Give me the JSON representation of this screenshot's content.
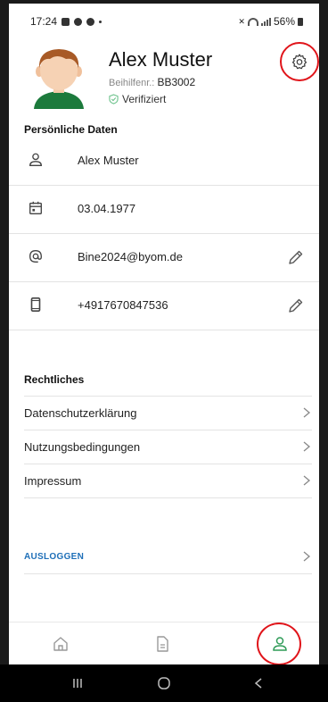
{
  "status_bar": {
    "time": "17:24",
    "battery": "56%"
  },
  "profile": {
    "name": "Alex Muster",
    "beihilfe_label": "Beihilfenr.:",
    "beihilfe_number": "BB3002",
    "verified_label": "Verifiziert"
  },
  "personal": {
    "title": "Persönliche Daten",
    "rows": [
      {
        "icon": "person-icon",
        "value": "Alex Muster",
        "editable": false
      },
      {
        "icon": "calendar-icon",
        "value": "03.04.1977",
        "editable": false
      },
      {
        "icon": "at-icon",
        "value": "Bine2024@byom.de",
        "editable": true
      },
      {
        "icon": "phone-icon",
        "value": "+4917670847536",
        "editable": true
      }
    ]
  },
  "legal": {
    "title": "Rechtliches",
    "items": [
      "Datenschutzerklärung",
      "Nutzungsbedingungen",
      "Impressum"
    ]
  },
  "logout_label": "AUSLOGGEN",
  "bottom_nav": {
    "items": [
      {
        "icon": "home-icon",
        "active": false
      },
      {
        "icon": "document-icon",
        "active": false
      },
      {
        "icon": "profile-icon",
        "active": true
      }
    ]
  },
  "colors": {
    "accent": "#1e6fb8",
    "active_green": "#2e9b57",
    "highlight_red": "#e0141a",
    "verified_green": "#6cc28b"
  }
}
